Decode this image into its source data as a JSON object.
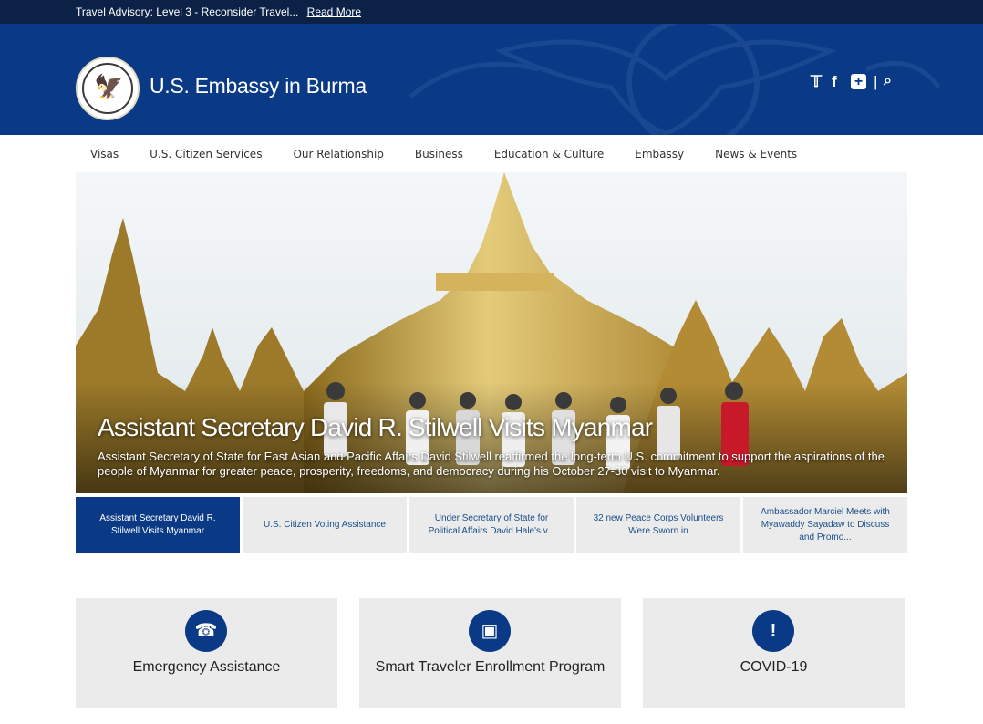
{
  "advisory": {
    "text": "Travel Advisory: Level 3 - Reconsider Travel...",
    "link": "Read More"
  },
  "header": {
    "site_title": "U.S. Embassy in Burma",
    "social": {
      "twitter": "twitter-icon",
      "facebook": "facebook-icon",
      "addthis": "plus-icon",
      "separator": "|",
      "search": "search-icon"
    }
  },
  "nav": {
    "items": [
      "Visas",
      "U.S. Citizen Services",
      "Our Relationship",
      "Business",
      "Education & Culture",
      "Embassy",
      "News & Events"
    ]
  },
  "hero": {
    "headline": "Assistant Secretary David R. Stilwell Visits Myanmar",
    "summary": "Assistant Secretary of State for East Asian and Pacific Affairs David Stilwell reaffirmed the long-term U.S. commitment to support the aspirations of the people of Myanmar for greater peace, prosperity, freedoms, and democracy during his October 27-30 visit to Myanmar."
  },
  "tabs": [
    "Assistant Secretary David R. Stilwell Visits Myanmar",
    "U.S. Citizen Voting Assistance",
    "Under Secretary of State for Political Affairs David Hale's v...",
    "32 new Peace Corps Volunteers Were Sworn in",
    "Ambassador Marciel Meets with Myawaddy Sayadaw to Discuss and Promo..."
  ],
  "cards": [
    {
      "label": "Emergency Assistance",
      "icon": "phone-icon"
    },
    {
      "label": "Smart Traveler Enrollment Program",
      "icon": "briefcase-icon"
    },
    {
      "label": "COVID-19",
      "icon": "exclamation-icon"
    }
  ],
  "colors": {
    "navy": "#0a3a86",
    "advisory_bar": "#0b2146",
    "accent_red": "#c0262e",
    "card_bg": "#ebebeb"
  }
}
